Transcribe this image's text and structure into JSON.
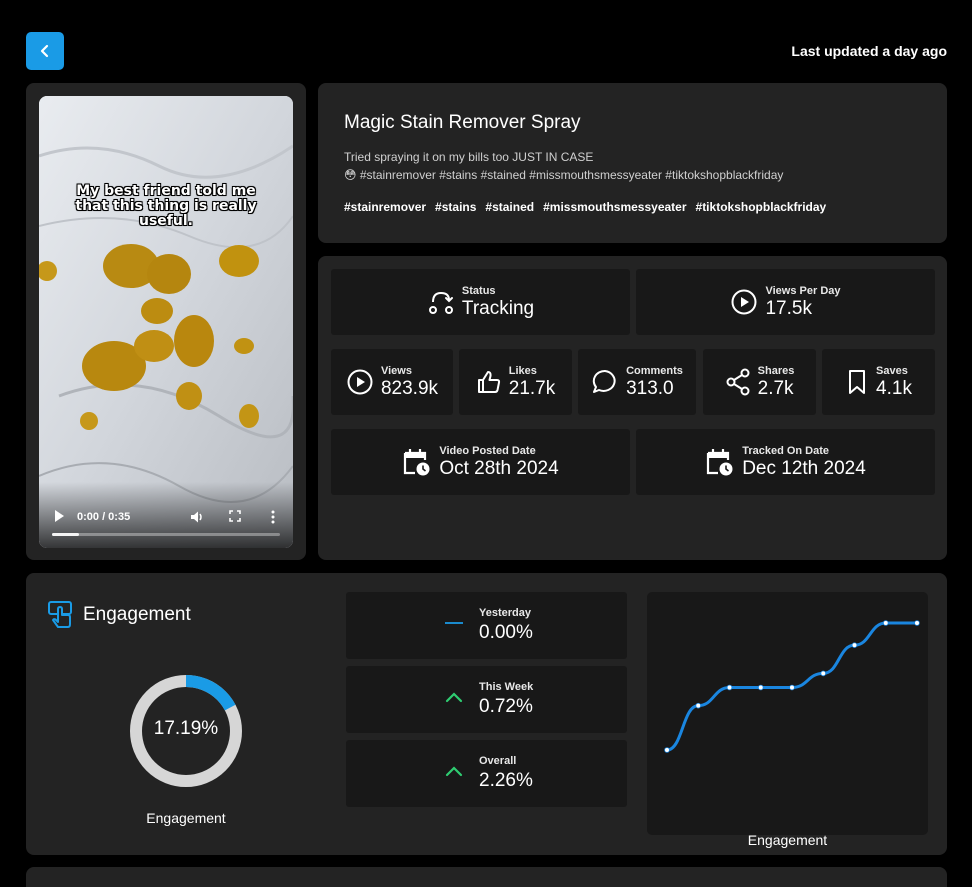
{
  "header": {
    "back_icon": "chevron-left-icon",
    "last_updated": "Last updated a day ago"
  },
  "video": {
    "overlay_caption": "My best friend told me that this thing is really useful.",
    "time": "0:00 / 0:35",
    "progress": 0.12,
    "icons": [
      "play-icon",
      "volume-icon",
      "fullscreen-icon",
      "more-vertical-icon"
    ]
  },
  "product": {
    "title": "Magic Stain Remover Spray",
    "description_line1": "Tried spraying it on my bills too JUST IN CASE",
    "description_line2": "😳 #stainremover #stains #stained #missmouthsmessyeater #tiktokshopblackfriday",
    "hashtags": [
      "#stainremover",
      "#stains",
      "#stained",
      "#missmouthsmessyeater",
      "#tiktokshopblackfriday"
    ]
  },
  "stats": {
    "status": {
      "label": "Status",
      "value": "Tracking",
      "icon": "tracking-route-icon"
    },
    "views_per_day": {
      "label": "Views Per Day",
      "value": "17.5k",
      "icon": "play-circle-icon"
    },
    "views": {
      "label": "Views",
      "value": "823.9k",
      "icon": "play-circle-icon"
    },
    "likes": {
      "label": "Likes",
      "value": "21.7k",
      "icon": "thumbs-up-icon"
    },
    "comments": {
      "label": "Comments",
      "value": "313.0",
      "icon": "comment-icon"
    },
    "shares": {
      "label": "Shares",
      "value": "2.7k",
      "icon": "share-icon"
    },
    "saves": {
      "label": "Saves",
      "value": "4.1k",
      "icon": "bookmark-icon"
    },
    "posted": {
      "label": "Video Posted Date",
      "value": "Oct 28th 2024",
      "icon": "calendar-clock-icon"
    },
    "tracked": {
      "label": "Tracked On Date",
      "value": "Dec 12th 2024",
      "icon": "calendar-clock-icon"
    }
  },
  "engagement": {
    "title": "Engagement",
    "icon": "tap-hand-icon",
    "rate": "17.19%",
    "rate_fraction": 0.1719,
    "donut_label": "Engagement",
    "trends": [
      {
        "label": "Yesterday",
        "value": "0.00%",
        "direction": "flat"
      },
      {
        "label": "This Week",
        "value": "0.72%",
        "direction": "up"
      },
      {
        "label": "Overall",
        "value": "2.26%",
        "direction": "up"
      }
    ],
    "chart_label": "Engagement"
  },
  "chart_data": {
    "type": "line",
    "title": "",
    "xlabel": "Engagement",
    "ylabel": "",
    "x": [
      1,
      2,
      3,
      4,
      5,
      6,
      7,
      8,
      9
    ],
    "series": [
      {
        "values": [
          0,
          2.2,
          3.1,
          3.1,
          3.1,
          3.8,
          5.2,
          6.3,
          6.3
        ]
      }
    ],
    "ylim": [
      0,
      6.3
    ],
    "grid": false,
    "colors": {
      "line": "#1a86e0",
      "points": "#ffffff"
    }
  },
  "colors": {
    "accent": "#1a9be6",
    "panel": "#232323",
    "card": "#181818",
    "up": "#2ecc71",
    "flat": "#1a9be6",
    "donut_track": "#d6d6d6",
    "donut_fill": "#1a9be6"
  }
}
